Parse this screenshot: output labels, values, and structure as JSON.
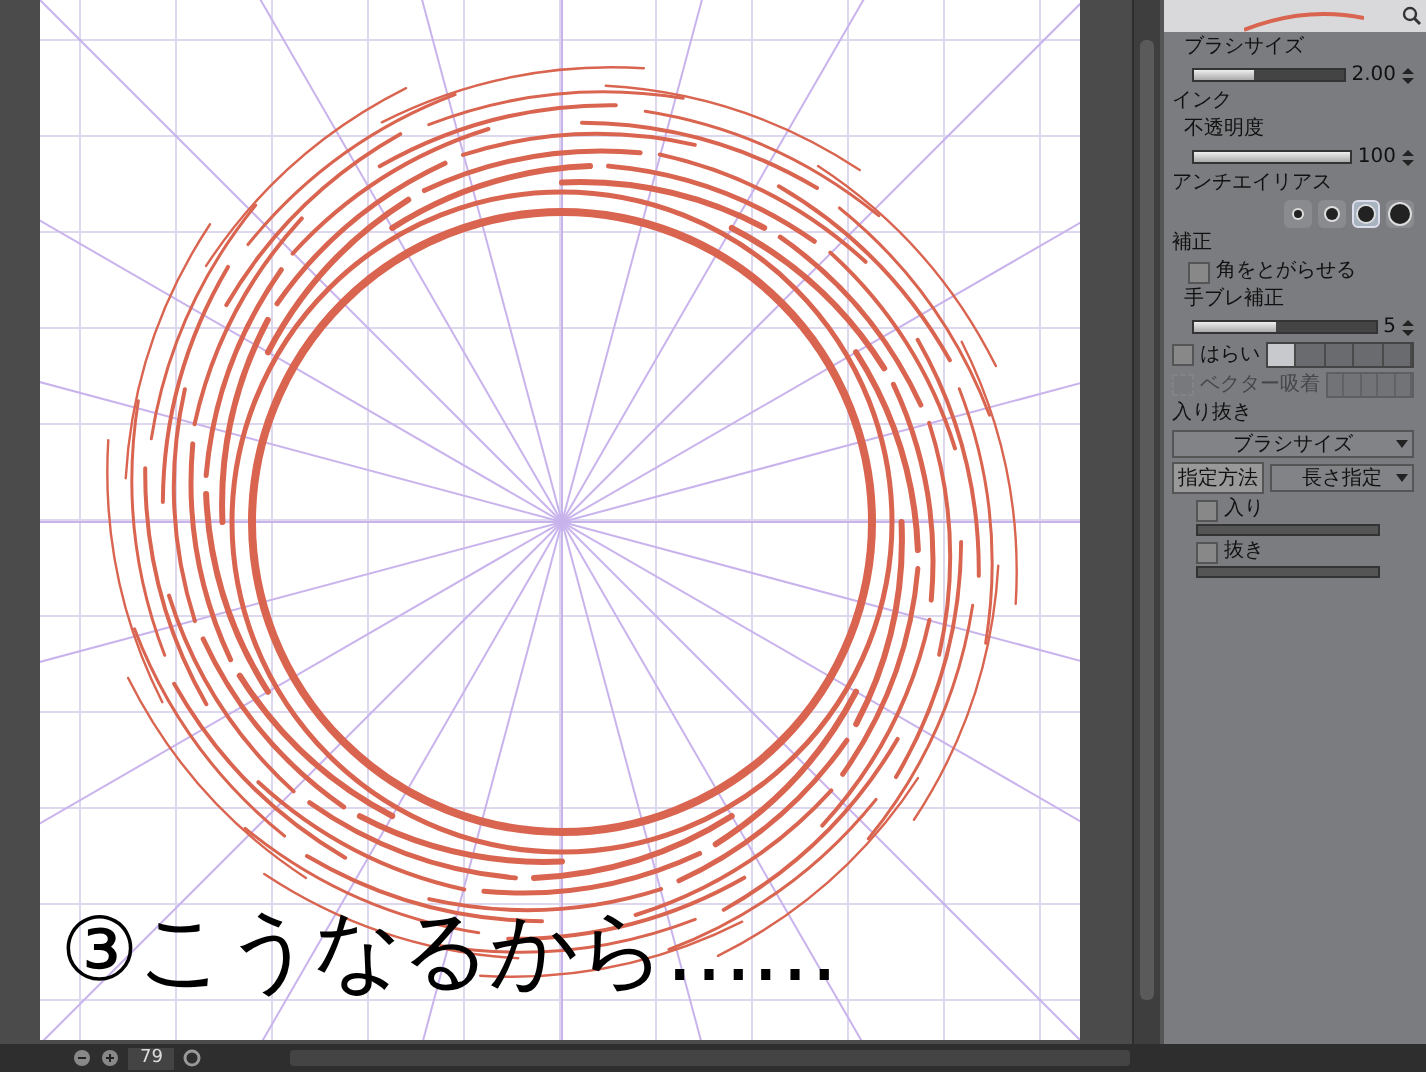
{
  "canvas": {
    "caption": "③こうなるから……"
  },
  "panel": {
    "items": [
      {
        "kind": "slider",
        "label": "ブラシサイズ",
        "value": "2.00",
        "level": 0.4
      },
      {
        "kind": "heading",
        "label": "インク"
      },
      {
        "kind": "slider",
        "label": "不透明度",
        "value": "100",
        "level": 1.0
      },
      {
        "kind": "dots",
        "label": "アンチエイリアス",
        "options": [
          {
            "selected": false
          },
          {
            "selected": false
          },
          {
            "selected": true
          },
          {
            "selected": false
          }
        ]
      },
      {
        "kind": "heading",
        "label": "補正"
      },
      {
        "kind": "checkbox",
        "label": "角をとがらせる",
        "checked": false,
        "disabled": false
      },
      {
        "kind": "slider",
        "label": "手ブレ補正",
        "value": "5",
        "level": 0.45
      },
      {
        "kind": "segments",
        "label": "はらい",
        "disabled": false,
        "checked": false,
        "options": [
          {
            "selected": true
          },
          {
            "selected": false
          },
          {
            "selected": false
          },
          {
            "selected": false
          },
          {
            "selected": false
          }
        ]
      },
      {
        "kind": "segments",
        "label": "ベクター吸着",
        "disabled": true,
        "checked": false,
        "options": [
          {
            "selected": false
          },
          {
            "selected": false
          },
          {
            "selected": false
          },
          {
            "selected": false
          },
          {
            "selected": false
          }
        ]
      },
      {
        "kind": "heading",
        "label": "入り抜き"
      },
      {
        "kind": "dropdown",
        "value": "ブラシサイズ"
      },
      {
        "kind": "dropdown",
        "label": "指定方法",
        "value": "長さ指定"
      },
      {
        "kind": "checktrack",
        "label": "入り",
        "checked": false
      },
      {
        "kind": "checktrack",
        "label": "抜き",
        "checked": false
      }
    ]
  },
  "status_bar": {
    "zoom": "79"
  }
}
